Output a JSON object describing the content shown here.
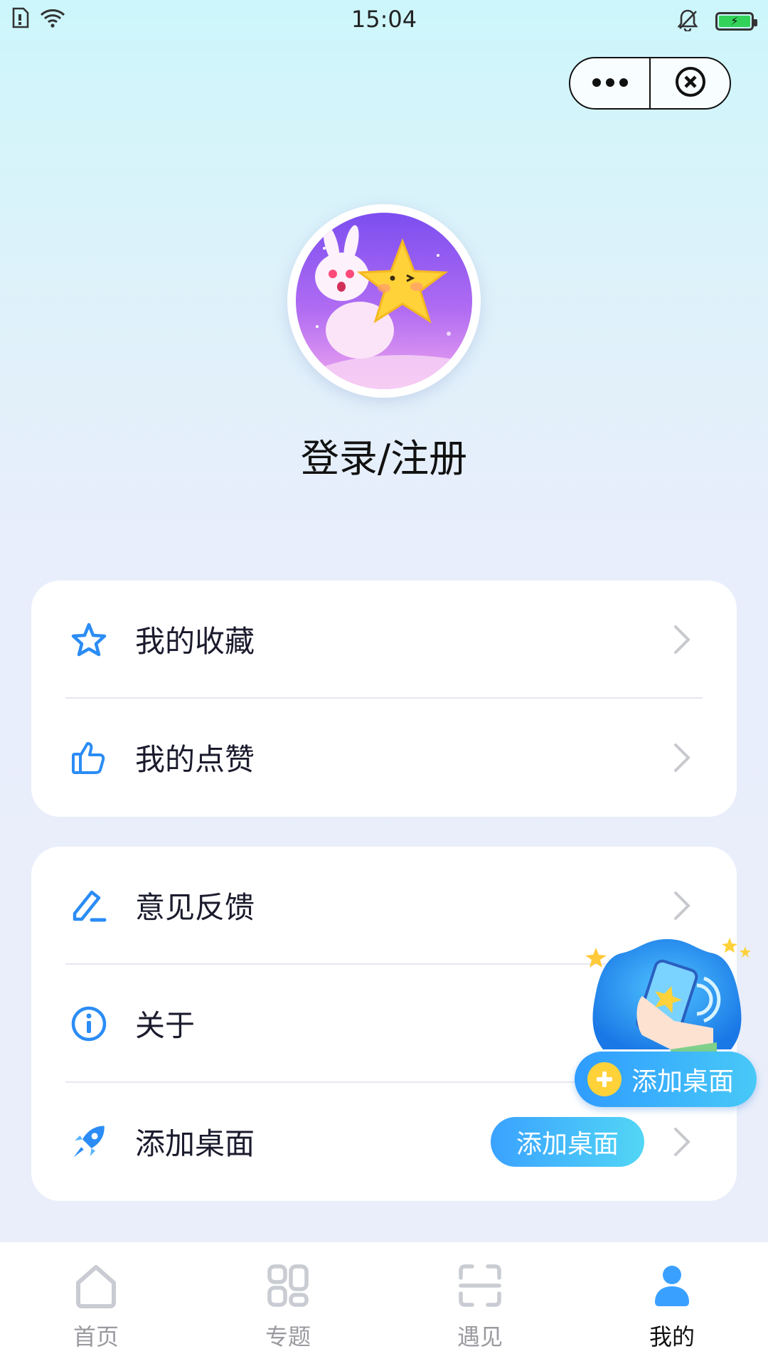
{
  "status_bar": {
    "time": "15:04",
    "icons": [
      "sim-card-icon",
      "wifi-icon",
      "bell-muted-icon",
      "battery-charging-icon"
    ]
  },
  "capsule": {
    "more_icon": "more-dots-icon",
    "close_icon": "close-circle-icon"
  },
  "profile": {
    "login_label": "登录/注册"
  },
  "menu_group_1": [
    {
      "icon": "star-icon",
      "label": "我的收藏"
    },
    {
      "icon": "thumb-up-icon",
      "label": "我的点赞"
    }
  ],
  "menu_group_2": [
    {
      "icon": "feedback-edit-icon",
      "label": "意见反馈"
    },
    {
      "icon": "info-icon",
      "label": "关于"
    },
    {
      "icon": "rocket-icon",
      "label": "添加桌面",
      "action_label": "添加桌面"
    }
  ],
  "floating_promo": {
    "label": "添加桌面"
  },
  "tabbar": [
    {
      "icon": "home-icon",
      "label": "首页",
      "active": false
    },
    {
      "icon": "topics-grid-icon",
      "label": "专题",
      "active": false
    },
    {
      "icon": "scan-icon",
      "label": "遇见",
      "active": false
    },
    {
      "icon": "user-icon",
      "label": "我的",
      "active": true
    }
  ],
  "colors": {
    "accent": "#2f9cff",
    "icon_blue": "#2b8cf5",
    "inactive_tab": "#c9ccd2",
    "active_tab": "#3aa0ff"
  }
}
